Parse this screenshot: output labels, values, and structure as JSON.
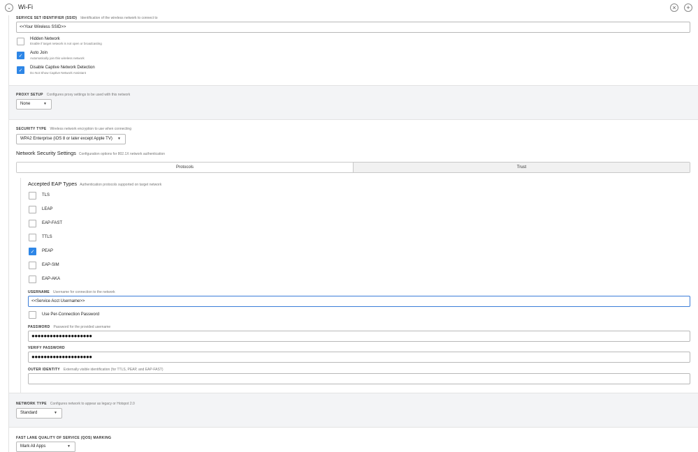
{
  "header": {
    "title": "Wi-Fi",
    "collapse_icon": "chevron-down-icon",
    "remove_icon": "close-icon",
    "add_icon": "plus-icon"
  },
  "ssid": {
    "label": "SERVICE SET IDENTIFIER (SSID)",
    "desc": "Identification of the wireless network to connect to",
    "value": "<<Your Wireless SSID>>",
    "options": [
      {
        "title": "Hidden Network",
        "sub": "Enable if target network is not open or broadcasting",
        "checked": false
      },
      {
        "title": "Auto Join",
        "sub": "Automatically join this wireless network",
        "checked": true
      },
      {
        "title": "Disable Captive Network Detection",
        "sub": "Do Not Show Captive Network Assistant",
        "checked": true
      }
    ]
  },
  "proxy": {
    "label": "PROXY SETUP",
    "desc": "Configures proxy settings to be used with this network",
    "value": "None"
  },
  "security": {
    "label": "SECURITY TYPE",
    "desc": "Wireless network encryption to use when connecting",
    "value": "WPA2 Enterprise (iOS 8 or later except Apple TV)",
    "nss_title": "Network Security Settings",
    "nss_desc": "Configuration options for 802.1X network authentication",
    "tabs": [
      "Protocols",
      "Trust"
    ]
  },
  "eap": {
    "title": "Accepted EAP Types",
    "desc": "Authentication protocols supported on target network",
    "types": [
      {
        "label": "TLS",
        "checked": false
      },
      {
        "label": "LEAP",
        "checked": false
      },
      {
        "label": "EAP-FAST",
        "checked": false
      },
      {
        "label": "TTLS",
        "checked": false
      },
      {
        "label": "PEAP",
        "checked": true
      },
      {
        "label": "EAP-SIM",
        "checked": false
      },
      {
        "label": "EAP-AKA",
        "checked": false
      }
    ],
    "username_label": "USERNAME",
    "username_desc": "Username for connection to the network",
    "username_value": "<<Service Acct Username>>",
    "per_connection": "Use Per-Connection Password",
    "password_label": "PASSWORD",
    "password_desc": "Password for the provided username",
    "password_value": "●●●●●●●●●●●●●●●●●●●●",
    "verify_label": "VERIFY PASSWORD",
    "verify_value": "●●●●●●●●●●●●●●●●●●●●",
    "outer_label": "OUTER IDENTITY",
    "outer_desc": "Externally visible identification (for TTLS, PEAP, and EAP-FAST)",
    "outer_value": ""
  },
  "network_type": {
    "label": "NETWORK TYPE",
    "desc": "Configures network to appear as legacy or Hotspot 2.0",
    "value": "Standard"
  },
  "qos": {
    "label": "FAST LANE QUALITY OF SERVICE (QOS) MARKING",
    "value": "Mark All Apps"
  },
  "colors": {
    "accent": "#2e86e6",
    "focus": "#3b7dd8",
    "section_bg": "#f3f4f6"
  }
}
